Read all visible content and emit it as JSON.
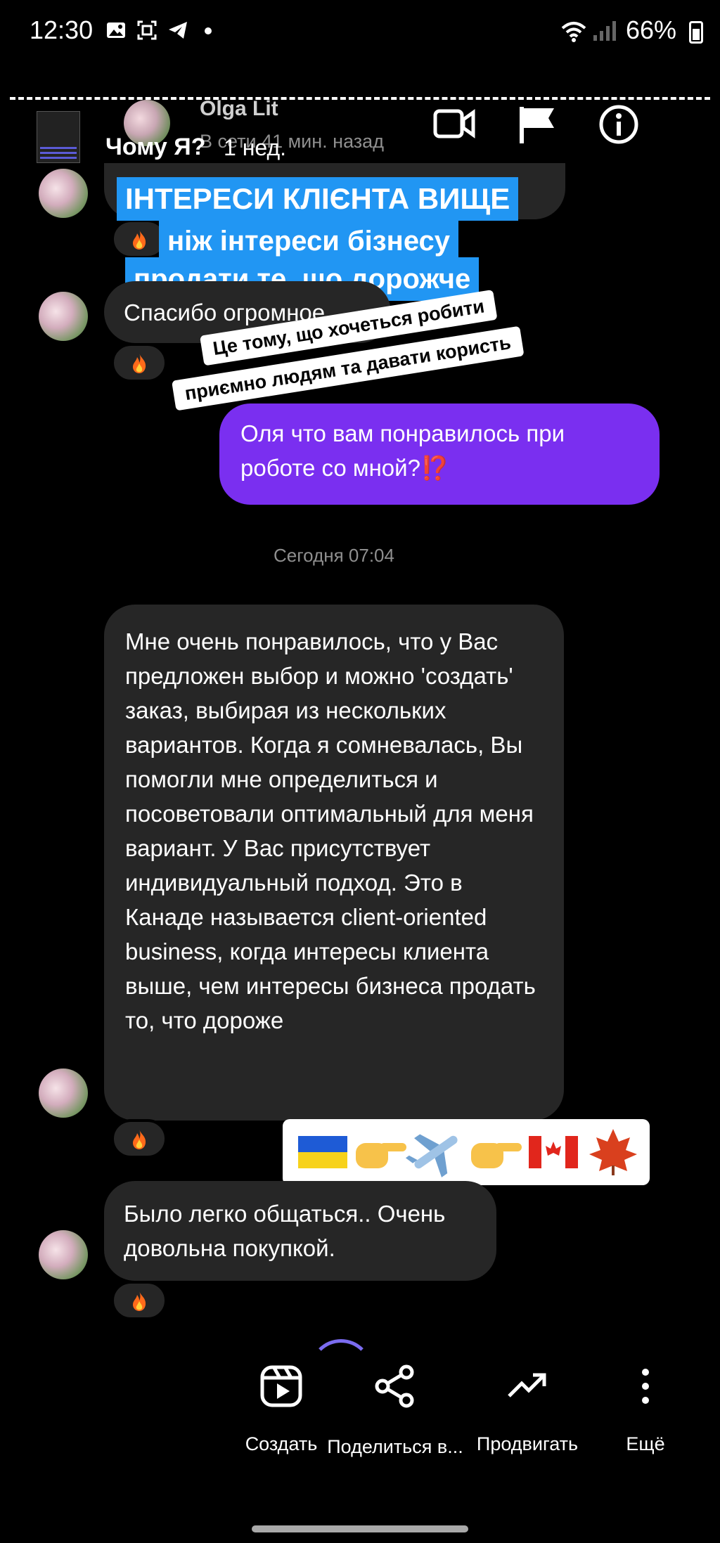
{
  "status_bar": {
    "time": "12:30",
    "battery": "66%"
  },
  "header": {
    "contact_name": "Olga Lit",
    "online_status": "В сети 41 мин. назад",
    "story_title": "Чому Я?",
    "story_ago": "1 нед."
  },
  "overlay": {
    "highlight_line1": "ІНТЕРЕСИ КЛІЄНТА ВИЩЕ",
    "highlight_line2": "ніж інтереси бізнесу",
    "highlight_line3": "продати те, що дорожче",
    "sticker_line1": "Це тому, що хочеться робити",
    "sticker_line2": "приємно людям та давати користь",
    "flag_emojis": "🇺🇦👉✈️👉🇨🇦🍁"
  },
  "messages": [
    {
      "from": "them",
      "text": "Спасибо огромное"
    },
    {
      "from": "me",
      "text": "Оля что вам понравилось при роботе со мной?⁉️"
    },
    {
      "from": "them",
      "text": "Мне очень понравилось, что у Вас предложен выбор и можно 'создать' заказ, выбирая из нескольких вариантов. Когда я сомневалась, Вы помогли мне определиться и посоветовали оптимальный для меня вариант. У Вас присутствует индивидуальный подход. Это в Канаде называется client-oriented business, когда интересы клиента выше, чем интересы бизнеса продать то, что дороже"
    },
    {
      "from": "them",
      "text": "Было легко общаться.. Очень довольна покупкой."
    }
  ],
  "date_separator": "Сегодня 07:04",
  "toolbar": {
    "create_label": "Создать",
    "share_label": "Поделиться в...",
    "promote_label": "Продвигать",
    "more_label": "Ещё"
  }
}
